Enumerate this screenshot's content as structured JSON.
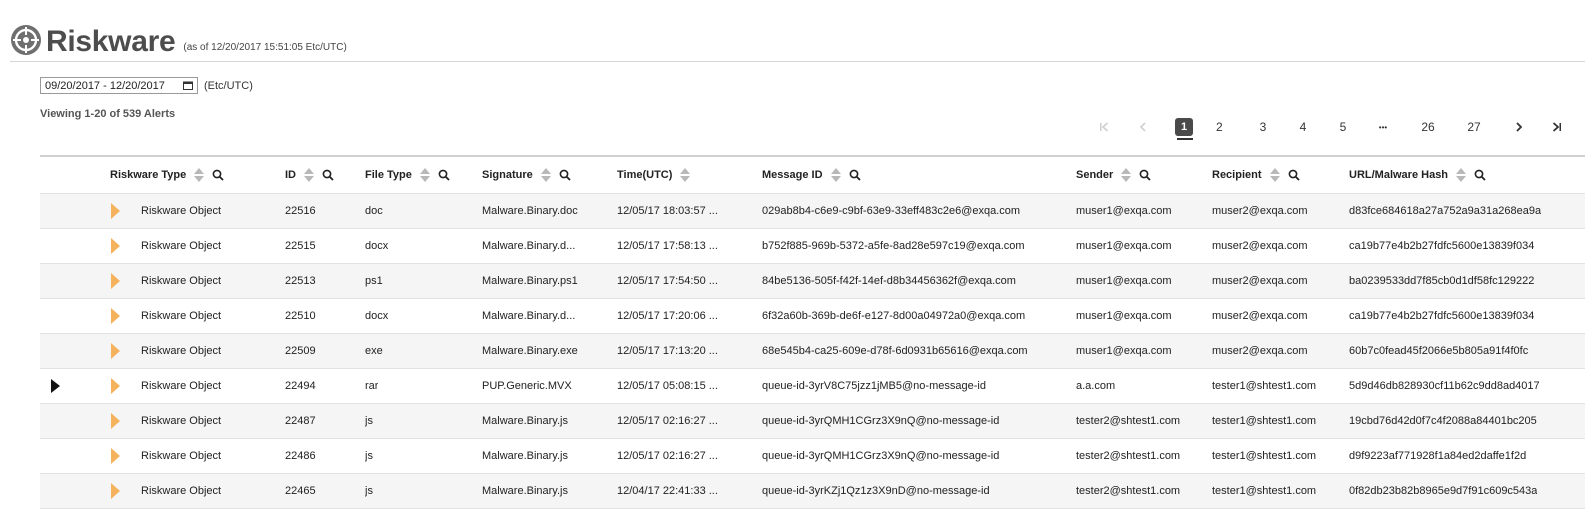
{
  "header": {
    "title": "Riskware",
    "as_of": "(as of 12/20/2017 15:51:05 Etc/UTC)"
  },
  "filter": {
    "date_range": "09/20/2017 - 12/20/2017",
    "timezone": "(Etc/UTC)"
  },
  "summary": {
    "viewing": "Viewing 1-20 of 539 Alerts"
  },
  "pagination": {
    "first": "⏮",
    "prev": "‹",
    "next": "›",
    "last": "⏭",
    "pages": [
      "1",
      "2",
      "3",
      "4",
      "5",
      "•••",
      "26",
      "27"
    ],
    "current_page": "1"
  },
  "table": {
    "columns": [
      "Riskware Type",
      "ID",
      "File Type",
      "Signature",
      "Time(UTC)",
      "Message ID",
      "Sender",
      "Recipient",
      "URL/Malware Hash"
    ],
    "rows": [
      {
        "type": "Riskware Object",
        "id": "22516",
        "file_type": "doc",
        "signature": "Malware.Binary.doc",
        "time": "12/05/17 18:03:57 ...",
        "message_id": "029ab8b4-c6e9-c9bf-63e9-33eff483c2e6@exqa.com",
        "sender": "muser1@exqa.com",
        "recipient": "muser2@exqa.com",
        "hash": "d83fce684618a27a752a9a31a268ea9a"
      },
      {
        "type": "Riskware Object",
        "id": "22515",
        "file_type": "docx",
        "signature": "Malware.Binary.d...",
        "time": "12/05/17 17:58:13 ...",
        "message_id": "b752f885-969b-5372-a5fe-8ad28e597c19@exqa.com",
        "sender": "muser1@exqa.com",
        "recipient": "muser2@exqa.com",
        "hash": "ca19b77e4b2b27fdfc5600e13839f034"
      },
      {
        "type": "Riskware Object",
        "id": "22513",
        "file_type": "ps1",
        "signature": "Malware.Binary.ps1",
        "time": "12/05/17 17:54:50 ...",
        "message_id": "84be5136-505f-f42f-14ef-d8b34456362f@exqa.com",
        "sender": "muser1@exqa.com",
        "recipient": "muser2@exqa.com",
        "hash": "ba0239533dd7f85cb0d1df58fc129222"
      },
      {
        "type": "Riskware Object",
        "id": "22510",
        "file_type": "docx",
        "signature": "Malware.Binary.d...",
        "time": "12/05/17 17:20:06 ...",
        "message_id": "6f32a60b-369b-de6f-e127-8d00a04972a0@exqa.com",
        "sender": "muser1@exqa.com",
        "recipient": "muser2@exqa.com",
        "hash": "ca19b77e4b2b27fdfc5600e13839f034"
      },
      {
        "type": "Riskware Object",
        "id": "22509",
        "file_type": "exe",
        "signature": "Malware.Binary.exe",
        "time": "12/05/17 17:13:20 ...",
        "message_id": "68e545b4-ca25-609e-d78f-6d0931b65616@exqa.com",
        "sender": "muser1@exqa.com",
        "recipient": "muser2@exqa.com",
        "hash": "60b7c0fead45f2066e5b805a91f4f0fc"
      },
      {
        "type": "Riskware Object",
        "id": "22494",
        "file_type": "rar",
        "signature": "PUP.Generic.MVX",
        "time": "12/05/17 05:08:15 ...",
        "message_id": "queue-id-3yrV8C75jzz1jMB5@no-message-id",
        "sender": "a.a.com",
        "recipient": "tester1@shtest1.com",
        "hash": "5d9d46db828930cf11b62c9dd8ad4017",
        "selected": true
      },
      {
        "type": "Riskware Object",
        "id": "22487",
        "file_type": "js",
        "signature": "Malware.Binary.js",
        "time": "12/05/17 02:16:27 ...",
        "message_id": "queue-id-3yrQMH1CGrz3X9nQ@no-message-id",
        "sender": "tester2@shtest1.com",
        "recipient": "tester1@shtest1.com",
        "hash": "19cbd76d42d0f7c4f2088a84401bc205"
      },
      {
        "type": "Riskware Object",
        "id": "22486",
        "file_type": "js",
        "signature": "Malware.Binary.js",
        "time": "12/05/17 02:16:27 ...",
        "message_id": "queue-id-3yrQMH1CGrz3X9nQ@no-message-id",
        "sender": "tester2@shtest1.com",
        "recipient": "tester1@shtest1.com",
        "hash": "d9f9223af771928f1a84ed2daffe1f2d"
      },
      {
        "type": "Riskware Object",
        "id": "22465",
        "file_type": "js",
        "signature": "Malware.Binary.js",
        "time": "12/04/17 22:41:33 ...",
        "message_id": "queue-id-3yrKZj1Qz1z3X9nD@no-message-id",
        "sender": "tester2@shtest1.com",
        "recipient": "tester1@shtest1.com",
        "hash": "0f82db23b82b8965e9d7f91c609c543a"
      }
    ]
  },
  "colors": {
    "accent": "#f5b25c",
    "active_page": "#4a4a4a",
    "alt_row": "#f5f5f5"
  },
  "icons": {
    "logo": "crosshair-globe-icon",
    "row_flag": "orange-triangle-icon",
    "selected_row": "black-triangle-icon"
  }
}
